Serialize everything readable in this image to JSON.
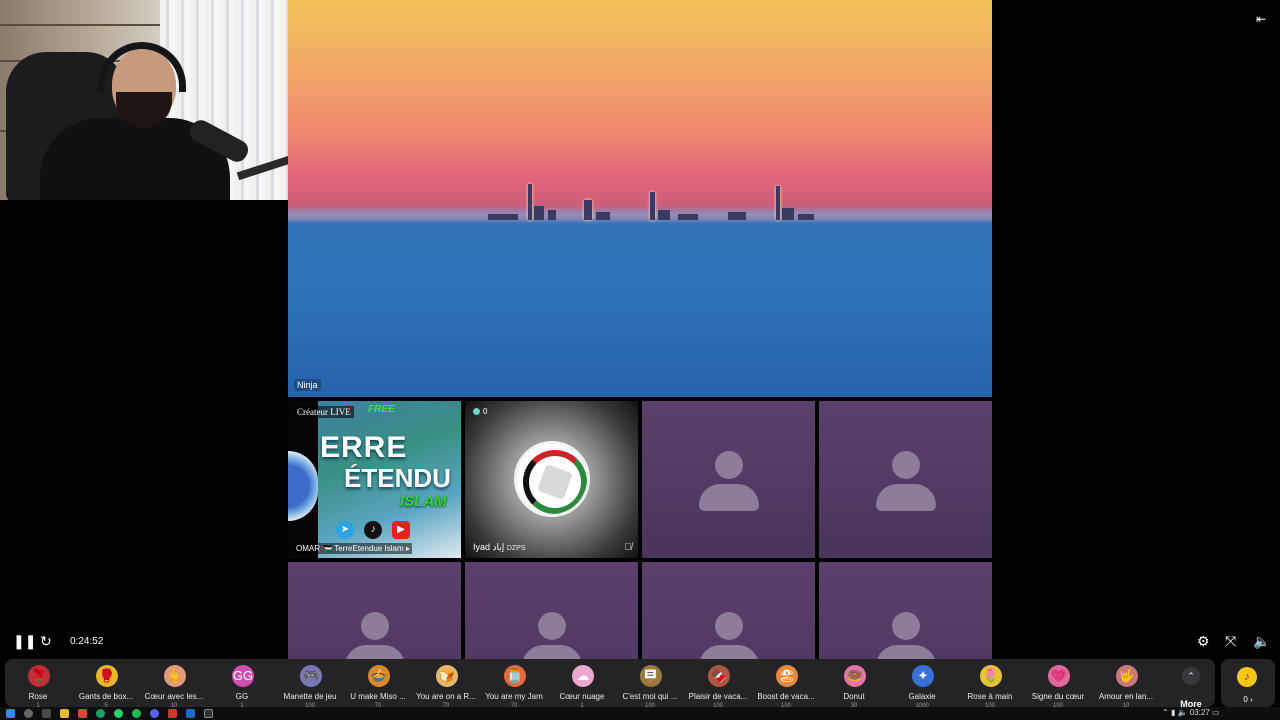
{
  "player": {
    "elapsed": "0:24:52",
    "pause_icon": "pause-icon",
    "refresh_icon": "refresh-icon"
  },
  "main_stage": {
    "host_name": "Ninja"
  },
  "guests": [
    {
      "creator_label": "Créateur LIVE",
      "name": "OMAR 🇵🇸 TerreEtendue Islam ▸",
      "free_text": "FREE",
      "title_line1": "ERRE",
      "title_line2": "ÉTENDU",
      "title_line3": "ISLAM"
    },
    {
      "count": "0",
      "name": "Iyad",
      "name_ar": "إياد",
      "tag": "DZPS"
    }
  ],
  "gifts": [
    {
      "label": "Rose",
      "price": "1",
      "icon": "rose-icon",
      "glyph": "🌹",
      "color": "#c0303a"
    },
    {
      "label": "Gants de box...",
      "price": "5",
      "icon": "boxing-glove-icon",
      "glyph": "🥊",
      "color": "#e6b82b"
    },
    {
      "label": "Cœur avec les...",
      "price": "10",
      "icon": "finger-heart-icon",
      "glyph": "🫰",
      "color": "#e19a7a"
    },
    {
      "label": "GG",
      "price": "1",
      "icon": "gg-icon",
      "glyph": "GG",
      "color": "#d04fb1"
    },
    {
      "label": "Manette de jeu",
      "price": "100",
      "icon": "gamepad-icon",
      "glyph": "🎮",
      "color": "#7a77b8"
    },
    {
      "label": "U make Miso ...",
      "price": "70",
      "icon": "miso-bowl-icon",
      "glyph": "🍲",
      "color": "#d98b2a"
    },
    {
      "label": "You are on a R...",
      "price": "70",
      "icon": "toast-icon",
      "glyph": "🍞",
      "color": "#e3b970"
    },
    {
      "label": "You are my Jam",
      "price": "70",
      "icon": "jam-jar-icon",
      "glyph": "🫙",
      "color": "#e36a3c"
    },
    {
      "label": "Cœur nuage",
      "price": "1",
      "icon": "cloud-heart-icon",
      "glyph": "☁",
      "color": "#e9a6d1"
    },
    {
      "label": "C'est moi qui ...",
      "price": "100",
      "icon": "sign-icon",
      "glyph": "🪧",
      "color": "#9b7a3e"
    },
    {
      "label": "Plaisir de vaca...",
      "price": "100",
      "icon": "chocolate-icon",
      "glyph": "🍫",
      "color": "#b0563c"
    },
    {
      "label": "Boost de vaca...",
      "price": "100",
      "icon": "beach-ball-icon",
      "glyph": "🏖",
      "color": "#e88a3b"
    },
    {
      "label": "Donut",
      "price": "30",
      "icon": "donut-icon",
      "glyph": "🍩",
      "color": "#e873a6"
    },
    {
      "label": "Galaxie",
      "price": "1000",
      "icon": "galaxy-icon",
      "glyph": "✦",
      "color": "#3a6fd8"
    },
    {
      "label": "Rose à main",
      "price": "100",
      "icon": "hand-rose-icon",
      "glyph": "🌷",
      "color": "#e8c33a"
    },
    {
      "label": "Signe du cœur",
      "price": "100",
      "icon": "heart-sign-icon",
      "glyph": "💗",
      "color": "#e06aa0"
    },
    {
      "label": "Amour en lan...",
      "price": "10",
      "icon": "love-hand-icon",
      "glyph": "🤟",
      "color": "#c9787a"
    }
  ],
  "more": {
    "label": "More",
    "icon": "chevron-up-icon"
  },
  "coins": {
    "value": "0 ›",
    "icon": "coin-icon"
  },
  "taskbar": {
    "clock": "03:27"
  }
}
